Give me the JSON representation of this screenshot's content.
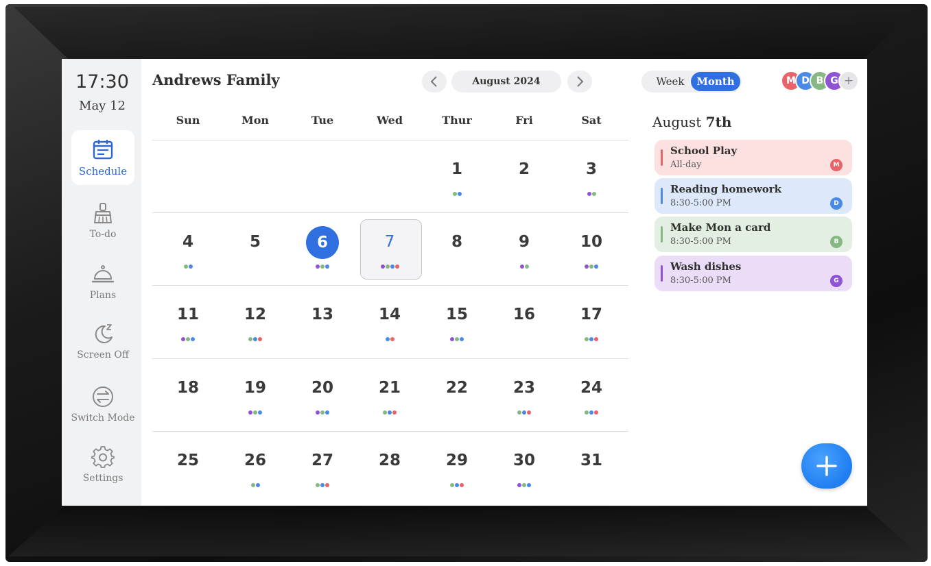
{
  "sidebar": {
    "time": "17:30",
    "date": "May 12",
    "items": [
      {
        "label": "Schedule",
        "icon": "calendar-icon",
        "active": true
      },
      {
        "label": "To-do",
        "icon": "broom-icon",
        "active": false
      },
      {
        "label": "Plans",
        "icon": "cloche-icon",
        "active": false
      },
      {
        "label": "Screen Off",
        "icon": "moon-sleep-icon",
        "active": false
      },
      {
        "label": "Switch Mode",
        "icon": "switch-arrows-icon",
        "active": false
      },
      {
        "label": "Settings",
        "icon": "gear-icon",
        "active": false
      }
    ]
  },
  "header": {
    "family_title": "Andrews Family",
    "month_label": "August 2024",
    "prev_icon": "chevron-left-icon",
    "next_icon": "chevron-right-icon",
    "view_week": "Week",
    "view_month": "Month",
    "active_view": "Month",
    "avatars": [
      {
        "letter": "M",
        "color": "#e8646a"
      },
      {
        "letter": "D",
        "color": "#4a8ae6"
      },
      {
        "letter": "B",
        "color": "#86b884"
      },
      {
        "letter": "G",
        "color": "#8f53d6"
      }
    ],
    "avatar_add": "+"
  },
  "calendar": {
    "weekdays": [
      "Sun",
      "Mon",
      "Tue",
      "Wed",
      "Thur",
      "Fri",
      "Sat"
    ],
    "today": "6",
    "selected": "7",
    "weeks": [
      [
        {
          "day": "",
          "dots": []
        },
        {
          "day": "",
          "dots": []
        },
        {
          "day": "",
          "dots": []
        },
        {
          "day": "",
          "dots": []
        },
        {
          "day": "1",
          "dots": [
            "#86b884",
            "#4a8ae6"
          ]
        },
        {
          "day": "2",
          "dots": []
        },
        {
          "day": "3",
          "dots": [
            "#8f53d6",
            "#86b884"
          ]
        }
      ],
      [
        {
          "day": "4",
          "dots": [
            "#86b884",
            "#4a8ae6"
          ]
        },
        {
          "day": "5",
          "dots": []
        },
        {
          "day": "6",
          "dots": [
            "#8f53d6",
            "#86b884",
            "#4a8ae6"
          ]
        },
        {
          "day": "7",
          "dots": [
            "#8f53d6",
            "#86b884",
            "#4a8ae6",
            "#e8646a"
          ]
        },
        {
          "day": "8",
          "dots": []
        },
        {
          "day": "9",
          "dots": [
            "#8f53d6",
            "#86b884"
          ]
        },
        {
          "day": "10",
          "dots": [
            "#8f53d6",
            "#86b884",
            "#4a8ae6"
          ]
        }
      ],
      [
        {
          "day": "11",
          "dots": [
            "#8f53d6",
            "#86b884",
            "#4a8ae6"
          ]
        },
        {
          "day": "12",
          "dots": [
            "#86b884",
            "#4a8ae6",
            "#e8646a"
          ]
        },
        {
          "day": "13",
          "dots": []
        },
        {
          "day": "14",
          "dots": [
            "#4a8ae6",
            "#e8646a"
          ]
        },
        {
          "day": "15",
          "dots": [
            "#8f53d6",
            "#86b884",
            "#4a8ae6"
          ]
        },
        {
          "day": "16",
          "dots": []
        },
        {
          "day": "17",
          "dots": [
            "#86b884",
            "#4a8ae6",
            "#e8646a"
          ]
        }
      ],
      [
        {
          "day": "18",
          "dots": []
        },
        {
          "day": "19",
          "dots": [
            "#8f53d6",
            "#86b884",
            "#4a8ae6"
          ]
        },
        {
          "day": "20",
          "dots": [
            "#8f53d6",
            "#86b884",
            "#4a8ae6"
          ]
        },
        {
          "day": "21",
          "dots": [
            "#86b884",
            "#4a8ae6",
            "#e8646a"
          ]
        },
        {
          "day": "22",
          "dots": []
        },
        {
          "day": "23",
          "dots": [
            "#86b884",
            "#4a8ae6",
            "#e8646a"
          ]
        },
        {
          "day": "24",
          "dots": [
            "#86b884",
            "#4a8ae6",
            "#e8646a"
          ]
        }
      ],
      [
        {
          "day": "25",
          "dots": []
        },
        {
          "day": "26",
          "dots": [
            "#86b884",
            "#4a8ae6"
          ]
        },
        {
          "day": "27",
          "dots": [
            "#86b884",
            "#4a8ae6",
            "#e8646a"
          ]
        },
        {
          "day": "28",
          "dots": []
        },
        {
          "day": "29",
          "dots": [
            "#86b884",
            "#4a8ae6",
            "#e8646a"
          ]
        },
        {
          "day": "30",
          "dots": [
            "#8f53d6",
            "#86b884",
            "#4a8ae6"
          ]
        },
        {
          "day": "31",
          "dots": []
        }
      ]
    ]
  },
  "day_panel": {
    "title_prefix": "August",
    "title_day": "7th",
    "events": [
      {
        "title": "School Play",
        "time": "All-day",
        "owner": "M",
        "bg": "#fde1e1",
        "accent": "#e8646a"
      },
      {
        "title": "Reading homework",
        "time": "8:30-5:00 PM",
        "owner": "D",
        "bg": "#dde9fb",
        "accent": "#4a8ae6"
      },
      {
        "title": "Make Mon a card",
        "time": "8:30-5:00 PM",
        "owner": "B",
        "bg": "#e3efe2",
        "accent": "#86b884"
      },
      {
        "title": "Wash dishes",
        "time": "8:30-5:00 PM",
        "owner": "G",
        "bg": "#ebdcf8",
        "accent": "#8f53d6"
      }
    ]
  },
  "fab": {
    "icon": "plus-icon"
  }
}
